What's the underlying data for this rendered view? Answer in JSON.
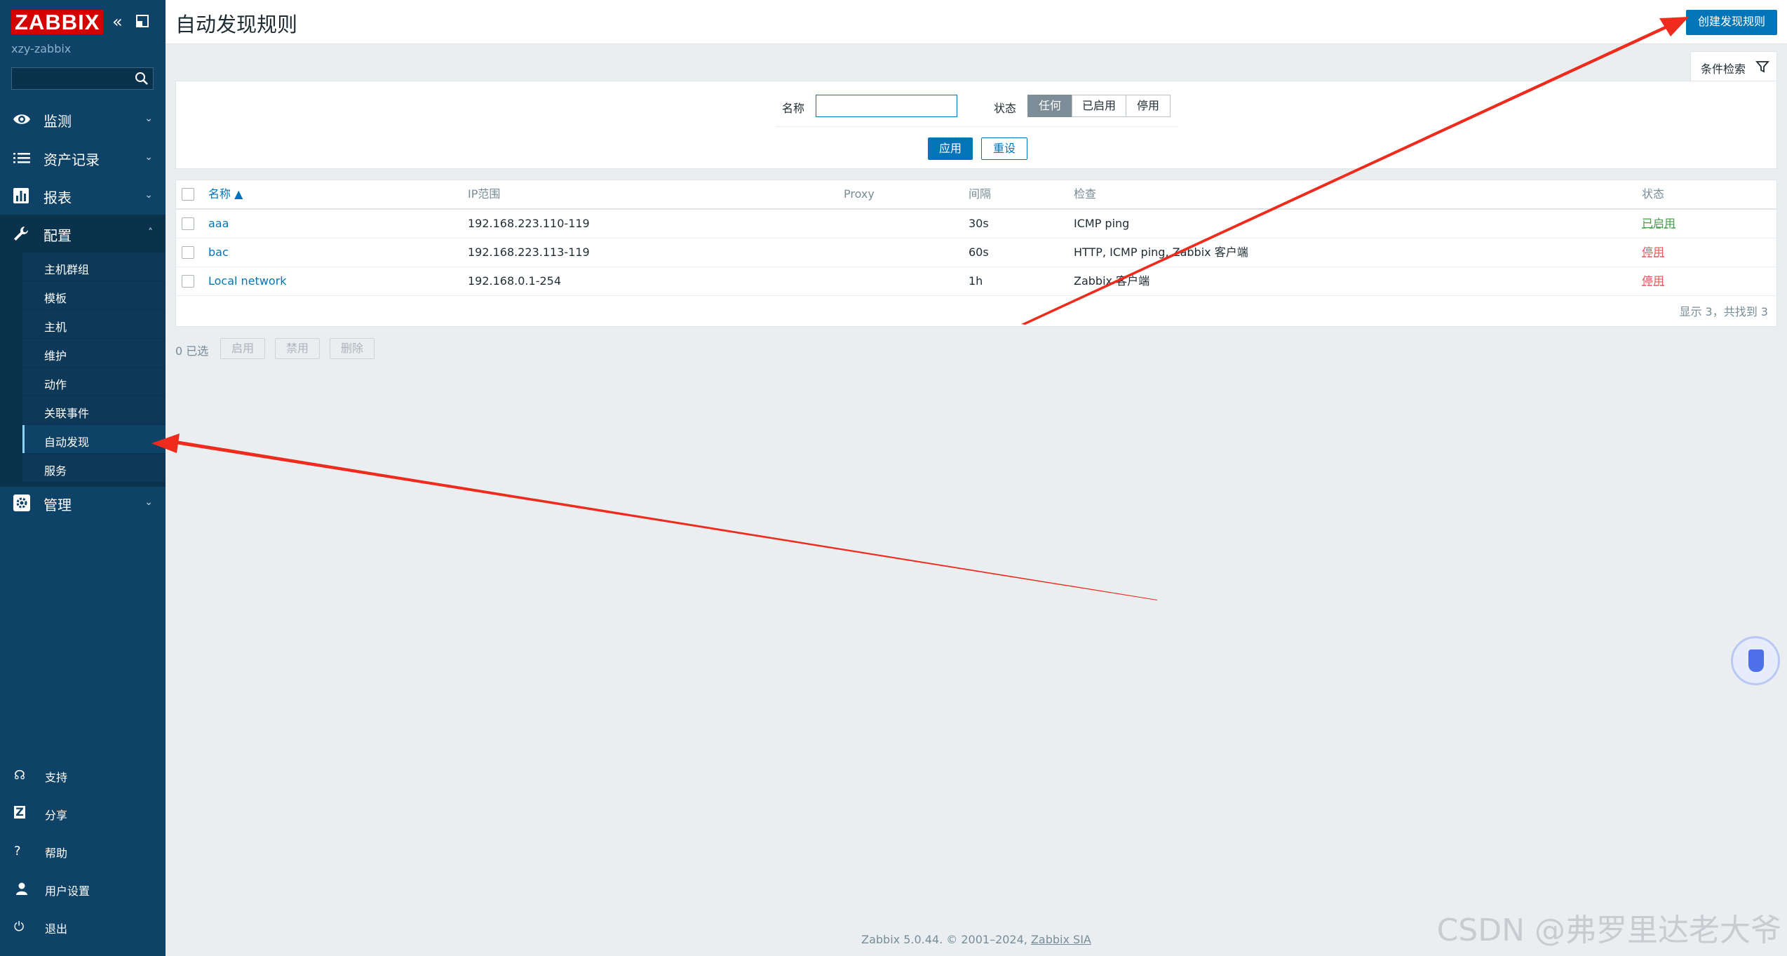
{
  "sidebar": {
    "logo": "ZABBIX",
    "server_name": "xzy-zabbix",
    "search_placeholder": "",
    "menu": [
      {
        "label": "监测",
        "icon": "eye-icon"
      },
      {
        "label": "资产记录",
        "icon": "list-icon"
      },
      {
        "label": "报表",
        "icon": "bar-chart-icon"
      },
      {
        "label": "配置",
        "icon": "wrench-icon"
      },
      {
        "label": "管理",
        "icon": "gear-icon"
      }
    ],
    "submenu": [
      "主机群组",
      "模板",
      "主机",
      "维护",
      "动作",
      "关联事件",
      "自动发现",
      "服务"
    ],
    "bottom": [
      {
        "label": "支持",
        "icon": "headset-icon"
      },
      {
        "label": "分享",
        "icon": "share-icon"
      },
      {
        "label": "帮助",
        "icon": "help-icon"
      },
      {
        "label": "用户设置",
        "icon": "user-icon"
      },
      {
        "label": "退出",
        "icon": "power-icon"
      }
    ]
  },
  "header": {
    "title": "自动发现规则",
    "create_button": "创建发现规则"
  },
  "filter": {
    "tab_label": "条件检索",
    "name_label": "名称",
    "name_value": "",
    "status_label": "状态",
    "status_options": [
      "任何",
      "已启用",
      "停用"
    ],
    "status_selected": "任何",
    "apply": "应用",
    "reset": "重设"
  },
  "table": {
    "columns": [
      "名称 ▲",
      "IP范围",
      "Proxy",
      "间隔",
      "检查",
      "状态"
    ],
    "rows": [
      {
        "name": "aaa",
        "ip": "192.168.223.110-119",
        "proxy": "",
        "interval": "30s",
        "checks": "ICMP ping",
        "status": "已启用"
      },
      {
        "name": "bac",
        "ip": "192.168.223.113-119",
        "proxy": "",
        "interval": "60s",
        "checks": "HTTP, ICMP ping, Zabbix 客户端",
        "status": "停用"
      },
      {
        "name": "Local network",
        "ip": "192.168.0.1-254",
        "proxy": "",
        "interval": "1h",
        "checks": "Zabbix 客户端",
        "status": "停用"
      }
    ],
    "footer": "显示 3，共找到 3"
  },
  "actions": {
    "selected": "0 已选",
    "enable": "启用",
    "disable": "禁用",
    "delete": "删除"
  },
  "footer": {
    "text": "Zabbix 5.0.44. © 2001–2024,",
    "link": "Zabbix SIA"
  },
  "watermark": "CSDN @弗罗里达老大爷",
  "colors": {
    "sidebar_bg": "#0e4266",
    "accent": "#0275b8",
    "enabled": "#429e47",
    "disabled": "#e45959",
    "arrow": "#ee2b1c"
  }
}
